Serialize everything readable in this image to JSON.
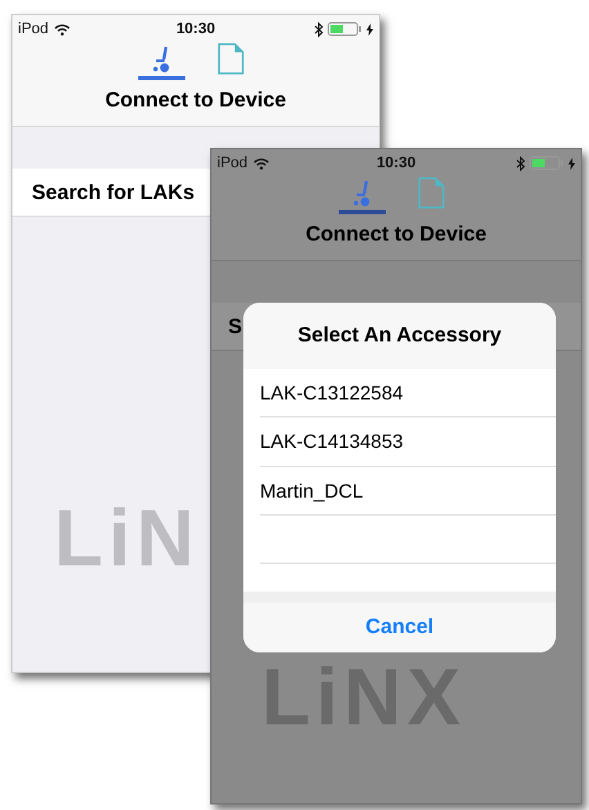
{
  "screens": [
    {
      "dimmed": false,
      "status_bar": {
        "carrier": "iPod",
        "time": "10:30"
      },
      "tabs": [
        {
          "kind": "chair",
          "selected": true
        },
        {
          "kind": "document",
          "selected": false
        }
      ],
      "title": "Connect to Device",
      "row": "Search for LAKs",
      "logo": "LiN"
    },
    {
      "dimmed": true,
      "status_bar": {
        "carrier": "iPod",
        "time": "10:30"
      },
      "tabs": [
        {
          "kind": "chair",
          "selected": true
        },
        {
          "kind": "document",
          "selected": false
        }
      ],
      "title": "Connect to Device",
      "row": "S",
      "logo": "LiNX",
      "dialog": {
        "title": "Select An Accessory",
        "items": [
          "LAK-C13122584",
          "LAK-C14134853",
          "Martin_DCL"
        ],
        "cancel": "Cancel"
      }
    }
  ]
}
